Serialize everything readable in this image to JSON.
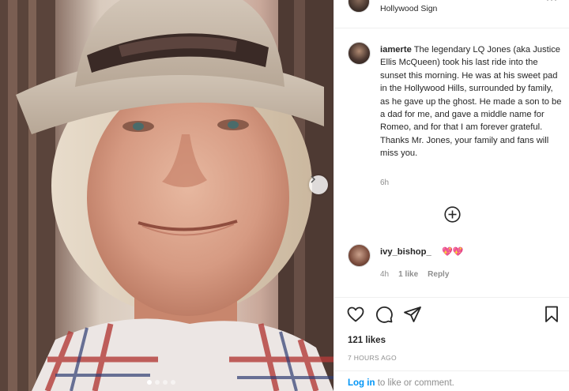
{
  "post": {
    "location": "Hollywood Sign",
    "more_glyph": "···",
    "caption_username": "iamerte",
    "caption_text": "The legendary LQ Jones (aka Justice Ellis McQueen) took his last ride into the sunset this morning. He was at his sweet pad in the Hollywood Hills, surrounded by family, as he gave up the ghost. He made a son to be a dad for me, and gave a middle name for Romeo, and for that I am forever grateful. Thanks Mr. Jones, your family and fans will miss you.",
    "caption_age": "6h",
    "likes": "121 likes",
    "posted": "7 HOURS AGO"
  },
  "comment": {
    "username": "ivy_bishop_",
    "emoji": "💖💖",
    "age": "4h",
    "likes": "1 like",
    "reply": "Reply"
  },
  "footer": {
    "login_link": "Log in",
    "login_rest": " to like or comment."
  },
  "carousel": {
    "current": 1,
    "count": 4
  },
  "icons": {
    "more": "more-horizontal-icon",
    "next": "chevron-right-icon",
    "load_more": "plus-circle-icon",
    "like": "heart-icon",
    "comment": "comment-icon",
    "share": "paper-plane-icon",
    "save": "bookmark-icon"
  },
  "colors": {
    "link": "#0095f6",
    "text": "#262626",
    "muted": "#8e8e8e",
    "border": "#efefef"
  }
}
